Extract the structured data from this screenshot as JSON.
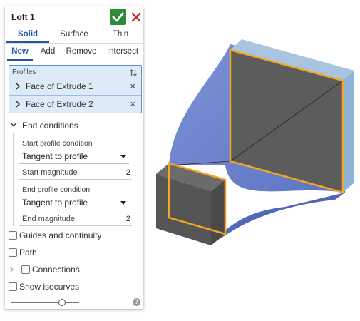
{
  "dialog": {
    "title": "Loft 1",
    "accent": "#1f56a5",
    "ok_color": "#2e8b3a",
    "cancel_color": "#cc2a2a"
  },
  "type_tabs": [
    {
      "label": "Solid",
      "active": true
    },
    {
      "label": "Surface",
      "active": false
    },
    {
      "label": "Thin",
      "active": false
    }
  ],
  "op_tabs": [
    {
      "label": "New",
      "active": true
    },
    {
      "label": "Add",
      "active": false
    },
    {
      "label": "Remove",
      "active": false
    },
    {
      "label": "Intersect",
      "active": false
    }
  ],
  "profiles": {
    "header": "Profiles",
    "items": [
      "Face of Extrude 1",
      "Face of Extrude 2"
    ]
  },
  "end_conditions": {
    "label": "End conditions",
    "start_condition_label": "Start profile condition",
    "start_condition_value": "Tangent to profile",
    "start_magnitude_label": "Start magnitude",
    "start_magnitude_value": "2",
    "end_condition_label": "End profile condition",
    "end_condition_value": "Tangent to profile",
    "end_magnitude_label": "End magnitude",
    "end_magnitude_value": "2"
  },
  "options": {
    "guides": "Guides and continuity",
    "path": "Path",
    "connections": "Connections",
    "isocurves": "Show isocurves"
  },
  "slider": {
    "level": 0.75
  },
  "icons": {
    "ok": "check-icon",
    "cancel": "close-icon",
    "sort": "sort-arrows-icon",
    "help": "help-icon"
  }
}
